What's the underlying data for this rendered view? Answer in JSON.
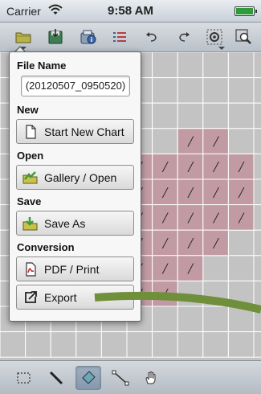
{
  "status_bar": {
    "carrier": "Carrier",
    "time": "9:58 AM"
  },
  "toolbar": {
    "buttons": [
      "folder-icon",
      "save-disk-icon",
      "info-icon",
      "list-icon",
      "undo-icon",
      "redo-icon",
      "settings-icon",
      "zoom-icon"
    ]
  },
  "file_menu": {
    "file_name_label": "File Name",
    "file_name_value": "(20120507_0950520)",
    "new_label": "New",
    "new_button": "Start New Chart",
    "open_label": "Open",
    "open_button": "Gallery / Open",
    "save_label": "Save",
    "save_button": "Save As",
    "conversion_label": "Conversion",
    "pdf_button": "PDF / Print",
    "export_button": "Export"
  },
  "bottom_toolbar": {
    "tools": [
      "select-rect-icon",
      "pen-icon",
      "eraser-icon",
      "line-tool-icon",
      "hand-icon"
    ],
    "active_tool": "eraser-icon"
  },
  "colors": {
    "grid_cell": "#c3c3c3",
    "stitch_fill": "#c19aa4",
    "stitch_mark": "#222222",
    "stroke_green": "#6f8f3a"
  },
  "grid_stitches": [
    {
      "col": 7,
      "row": 3,
      "glyph": "/"
    },
    {
      "col": 8,
      "row": 3,
      "glyph": "/"
    },
    {
      "col": 5,
      "row": 4,
      "glyph": "/"
    },
    {
      "col": 6,
      "row": 4,
      "glyph": "/"
    },
    {
      "col": 7,
      "row": 4,
      "glyph": "/"
    },
    {
      "col": 8,
      "row": 4,
      "glyph": "/"
    },
    {
      "col": 9,
      "row": 4,
      "glyph": "/"
    },
    {
      "col": 5,
      "row": 5,
      "glyph": "/"
    },
    {
      "col": 6,
      "row": 5,
      "glyph": "/"
    },
    {
      "col": 7,
      "row": 5,
      "glyph": "/"
    },
    {
      "col": 8,
      "row": 5,
      "glyph": "/"
    },
    {
      "col": 9,
      "row": 5,
      "glyph": "/"
    },
    {
      "col": 5,
      "row": 6,
      "glyph": "/"
    },
    {
      "col": 6,
      "row": 6,
      "glyph": "/"
    },
    {
      "col": 7,
      "row": 6,
      "glyph": "/"
    },
    {
      "col": 8,
      "row": 6,
      "glyph": "/"
    },
    {
      "col": 9,
      "row": 6,
      "glyph": "/"
    },
    {
      "col": 5,
      "row": 7,
      "glyph": "/"
    },
    {
      "col": 6,
      "row": 7,
      "glyph": "/"
    },
    {
      "col": 7,
      "row": 7,
      "glyph": "/"
    },
    {
      "col": 8,
      "row": 7,
      "glyph": "/"
    },
    {
      "col": 5,
      "row": 8,
      "glyph": "/"
    },
    {
      "col": 6,
      "row": 8,
      "glyph": "/"
    },
    {
      "col": 7,
      "row": 8,
      "glyph": "/"
    },
    {
      "col": 5,
      "row": 9,
      "glyph": "/"
    },
    {
      "col": 6,
      "row": 9,
      "glyph": "/"
    }
  ]
}
